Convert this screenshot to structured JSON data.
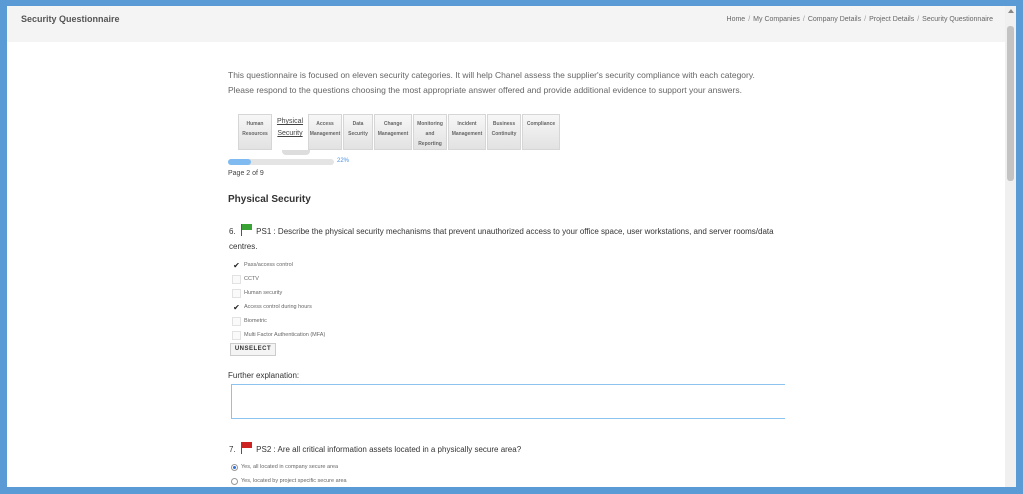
{
  "header": {
    "title": "Security Questionnaire",
    "breadcrumb": [
      "Home",
      "My Companies",
      "Company Details",
      "Project Details",
      "Security Questionnaire"
    ]
  },
  "intro": {
    "text": "This questionnaire is focused on eleven security categories. It will help Chanel assess the supplier's security compliance with each category. Please respond to the questions choosing the most appropriate answer offered and provide additional evidence to support your answers."
  },
  "tabs": [
    {
      "label": "Human Resources",
      "active": false
    },
    {
      "label": "Physical Security",
      "active": true
    },
    {
      "label": "Access Management",
      "active": false
    },
    {
      "label": "Data Security",
      "active": false
    },
    {
      "label": "Change Management",
      "active": false
    },
    {
      "label": "Monitoring and Reporting",
      "active": false
    },
    {
      "label": "Incident Management",
      "active": false
    },
    {
      "label": "Business Continuity",
      "active": false
    },
    {
      "label": "Compliance",
      "active": false
    }
  ],
  "progress": {
    "percent": 22,
    "label": "22%",
    "page_text": "Page 2 of 9"
  },
  "section": {
    "title": "Physical Security"
  },
  "question1": {
    "number": "6.",
    "flag_color": "#3aa335",
    "text": "PS1 : Describe the physical security mechanisms that prevent unauthorized access to your office space, user workstations, and server rooms/data centres.",
    "options": [
      {
        "label": "Pass/access control",
        "checked": true
      },
      {
        "label": "CCTV",
        "checked": false
      },
      {
        "label": "Human security",
        "checked": false
      },
      {
        "label": "Access control during hours",
        "checked": true
      },
      {
        "label": "Biometric",
        "checked": false
      },
      {
        "label": "Multi Factor Authentication (MFA)",
        "checked": false
      }
    ],
    "unselect_label": "UNSELECT",
    "further_label": "Further explanation:",
    "further_value": ""
  },
  "question2": {
    "number": "7.",
    "flag_color": "#cc2222",
    "text": "PS2 : Are all critical information assets located in a physically secure area?",
    "options": [
      {
        "label": "Yes, all located in company secure area",
        "selected": true
      },
      {
        "label": "Yes, located by project specific secure area",
        "selected": false
      }
    ]
  }
}
